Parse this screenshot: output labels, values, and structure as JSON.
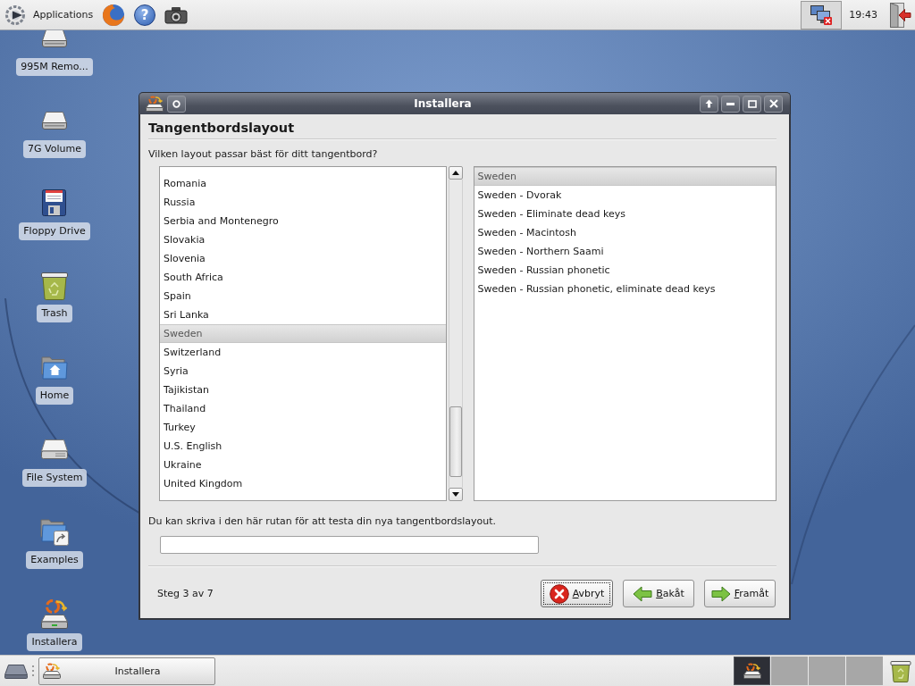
{
  "top_panel": {
    "menu_label": "Applications",
    "help_glyph": "?",
    "clock": "19:43"
  },
  "desktop_icons": [
    {
      "label": "995M Remo...",
      "kind": "drive"
    },
    {
      "label": "7G Volume",
      "kind": "drive"
    },
    {
      "label": "Floppy Drive",
      "kind": "floppy"
    },
    {
      "label": "Trash",
      "kind": "trash"
    },
    {
      "label": "Home",
      "kind": "home"
    },
    {
      "label": "File System",
      "kind": "harddisk"
    },
    {
      "label": "Examples",
      "kind": "folder-link"
    },
    {
      "label": "Installera",
      "kind": "installer"
    }
  ],
  "window": {
    "title": "Installera",
    "heading": "Tangentbordslayout",
    "question": "Vilken layout passar bäst för ditt tangentbord?",
    "layouts": [
      {
        "label": "Romania",
        "selected": false
      },
      {
        "label": "Russia",
        "selected": false
      },
      {
        "label": "Serbia and Montenegro",
        "selected": false
      },
      {
        "label": "Slovakia",
        "selected": false
      },
      {
        "label": "Slovenia",
        "selected": false
      },
      {
        "label": "South Africa",
        "selected": false
      },
      {
        "label": "Spain",
        "selected": false
      },
      {
        "label": "Sri Lanka",
        "selected": false
      },
      {
        "label": "Sweden",
        "selected": true
      },
      {
        "label": "Switzerland",
        "selected": false
      },
      {
        "label": "Syria",
        "selected": false
      },
      {
        "label": "Tajikistan",
        "selected": false
      },
      {
        "label": "Thailand",
        "selected": false
      },
      {
        "label": "Turkey",
        "selected": false
      },
      {
        "label": "U.S. English",
        "selected": false
      },
      {
        "label": "Ukraine",
        "selected": false
      },
      {
        "label": "United Kingdom",
        "selected": false
      }
    ],
    "variants": [
      {
        "label": "Sweden",
        "selected": true
      },
      {
        "label": "Sweden - Dvorak",
        "selected": false
      },
      {
        "label": "Sweden - Eliminate dead keys",
        "selected": false
      },
      {
        "label": "Sweden - Macintosh",
        "selected": false
      },
      {
        "label": "Sweden - Northern Saami",
        "selected": false
      },
      {
        "label": "Sweden - Russian phonetic",
        "selected": false
      },
      {
        "label": "Sweden - Russian phonetic, eliminate dead keys",
        "selected": false
      }
    ],
    "test_prompt": "Du kan skriva i den här rutan för att testa din nya tangentbordslayout.",
    "step": "Steg 3 av 7",
    "buttons": [
      {
        "label": "Avbryt",
        "kind": "cancel",
        "focused": true,
        "mnemonic_underlined": true
      },
      {
        "label": "Bakåt",
        "kind": "back",
        "focused": false,
        "mnemonic_underlined": true
      },
      {
        "label": "Framåt",
        "kind": "forward",
        "focused": false,
        "mnemonic_underlined": true
      }
    ]
  },
  "taskbar": {
    "tasks": [
      {
        "label": "Installera"
      }
    ],
    "workspaces": [
      {
        "selected": true,
        "has_window": true
      },
      {
        "selected": false,
        "has_window": false
      },
      {
        "selected": false,
        "has_window": false
      },
      {
        "selected": false,
        "has_window": false
      }
    ]
  }
}
